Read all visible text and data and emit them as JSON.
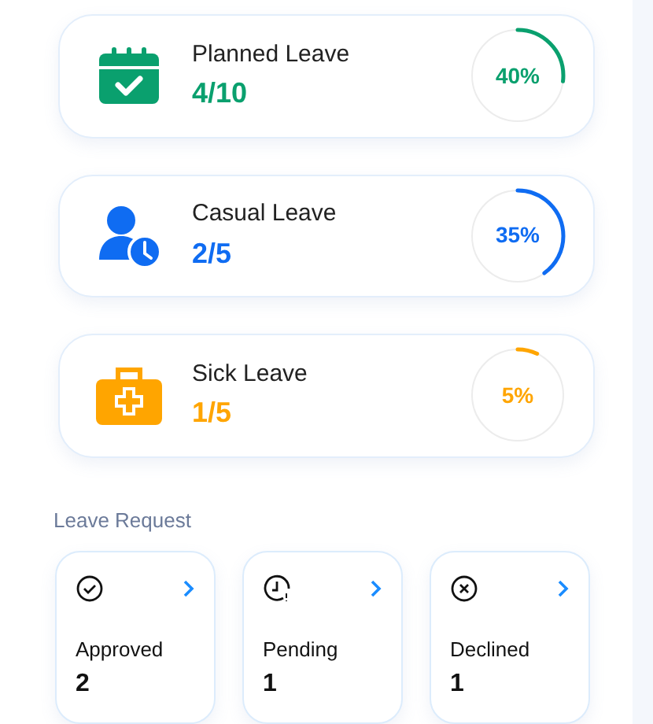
{
  "leave_balances": [
    {
      "kind": "calendar",
      "title": "Planned Leave",
      "count": "4/10",
      "percent": "40%",
      "color": "#0aa06e"
    },
    {
      "kind": "person-clock",
      "title": "Casual Leave",
      "count": "2/5",
      "percent": "35%",
      "color": "#0f6cf2"
    },
    {
      "kind": "medical-kit",
      "title": "Sick Leave",
      "count": "1/5",
      "percent": "5%",
      "color": "#ffa500"
    }
  ],
  "leave_request": {
    "heading": "Leave Request",
    "items": [
      {
        "kind": "approved",
        "label": "Approved",
        "count": "2"
      },
      {
        "kind": "pending",
        "label": "Pending",
        "count": "1"
      },
      {
        "kind": "declined",
        "label": "Declined",
        "count": "1"
      }
    ]
  }
}
